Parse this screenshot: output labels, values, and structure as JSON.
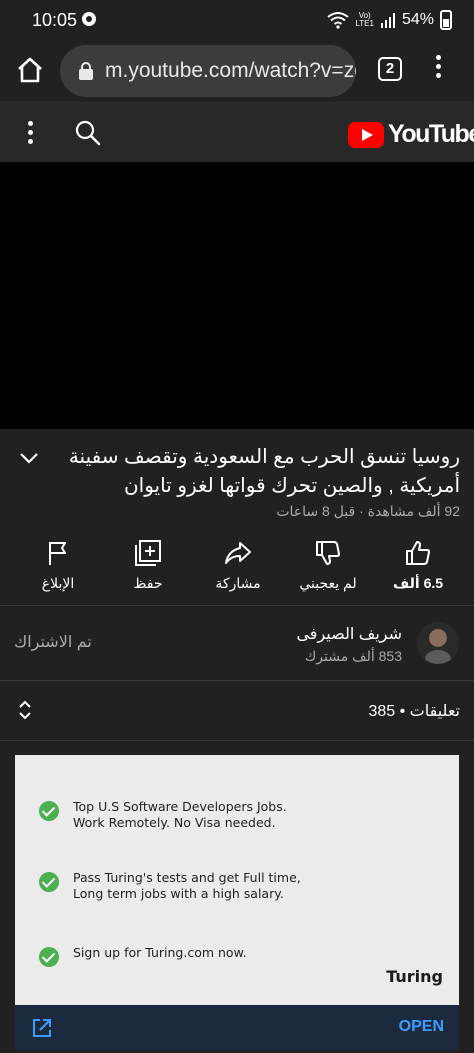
{
  "status_bar": {
    "time": "10:05",
    "lte_top": "Vo)",
    "lte_bottom": "LTE1",
    "battery": "54%"
  },
  "browser": {
    "url": "m.youtube.com/watch?v=zg",
    "tab_count": "2"
  },
  "youtube": {
    "logo_text": "YouTube"
  },
  "video": {
    "title": "روسيا تنسق الحرب مع السعودية وتقصف سفينة أمريكية , والصين تحرك قواتها لغزو تايوان",
    "meta": "92 ألف مشاهدة · قبل 8 ساعات"
  },
  "actions": {
    "like": "6.5 ألف",
    "dislike": "لم يعجبني",
    "share": "مشاركة",
    "save": "حفظ",
    "report": "الإبلاغ"
  },
  "channel": {
    "name": "شريف الصيرفى",
    "subscribers": "853 ألف مشترك",
    "subscribe_state": "تم الاشتراك"
  },
  "comments": {
    "label": "تعليقات • 385"
  },
  "ad": {
    "items": [
      "Top U.S Software Developers Jobs.\nWork Remotely. No Visa needed.",
      "Pass Turing's tests and get Full time,\nLong term jobs with a high salary.",
      "Sign up for Turing.com now."
    ],
    "brand": "Turing",
    "cta": "OPEN",
    "check_color": "#4caf50",
    "cta_color": "#3e9cff"
  }
}
